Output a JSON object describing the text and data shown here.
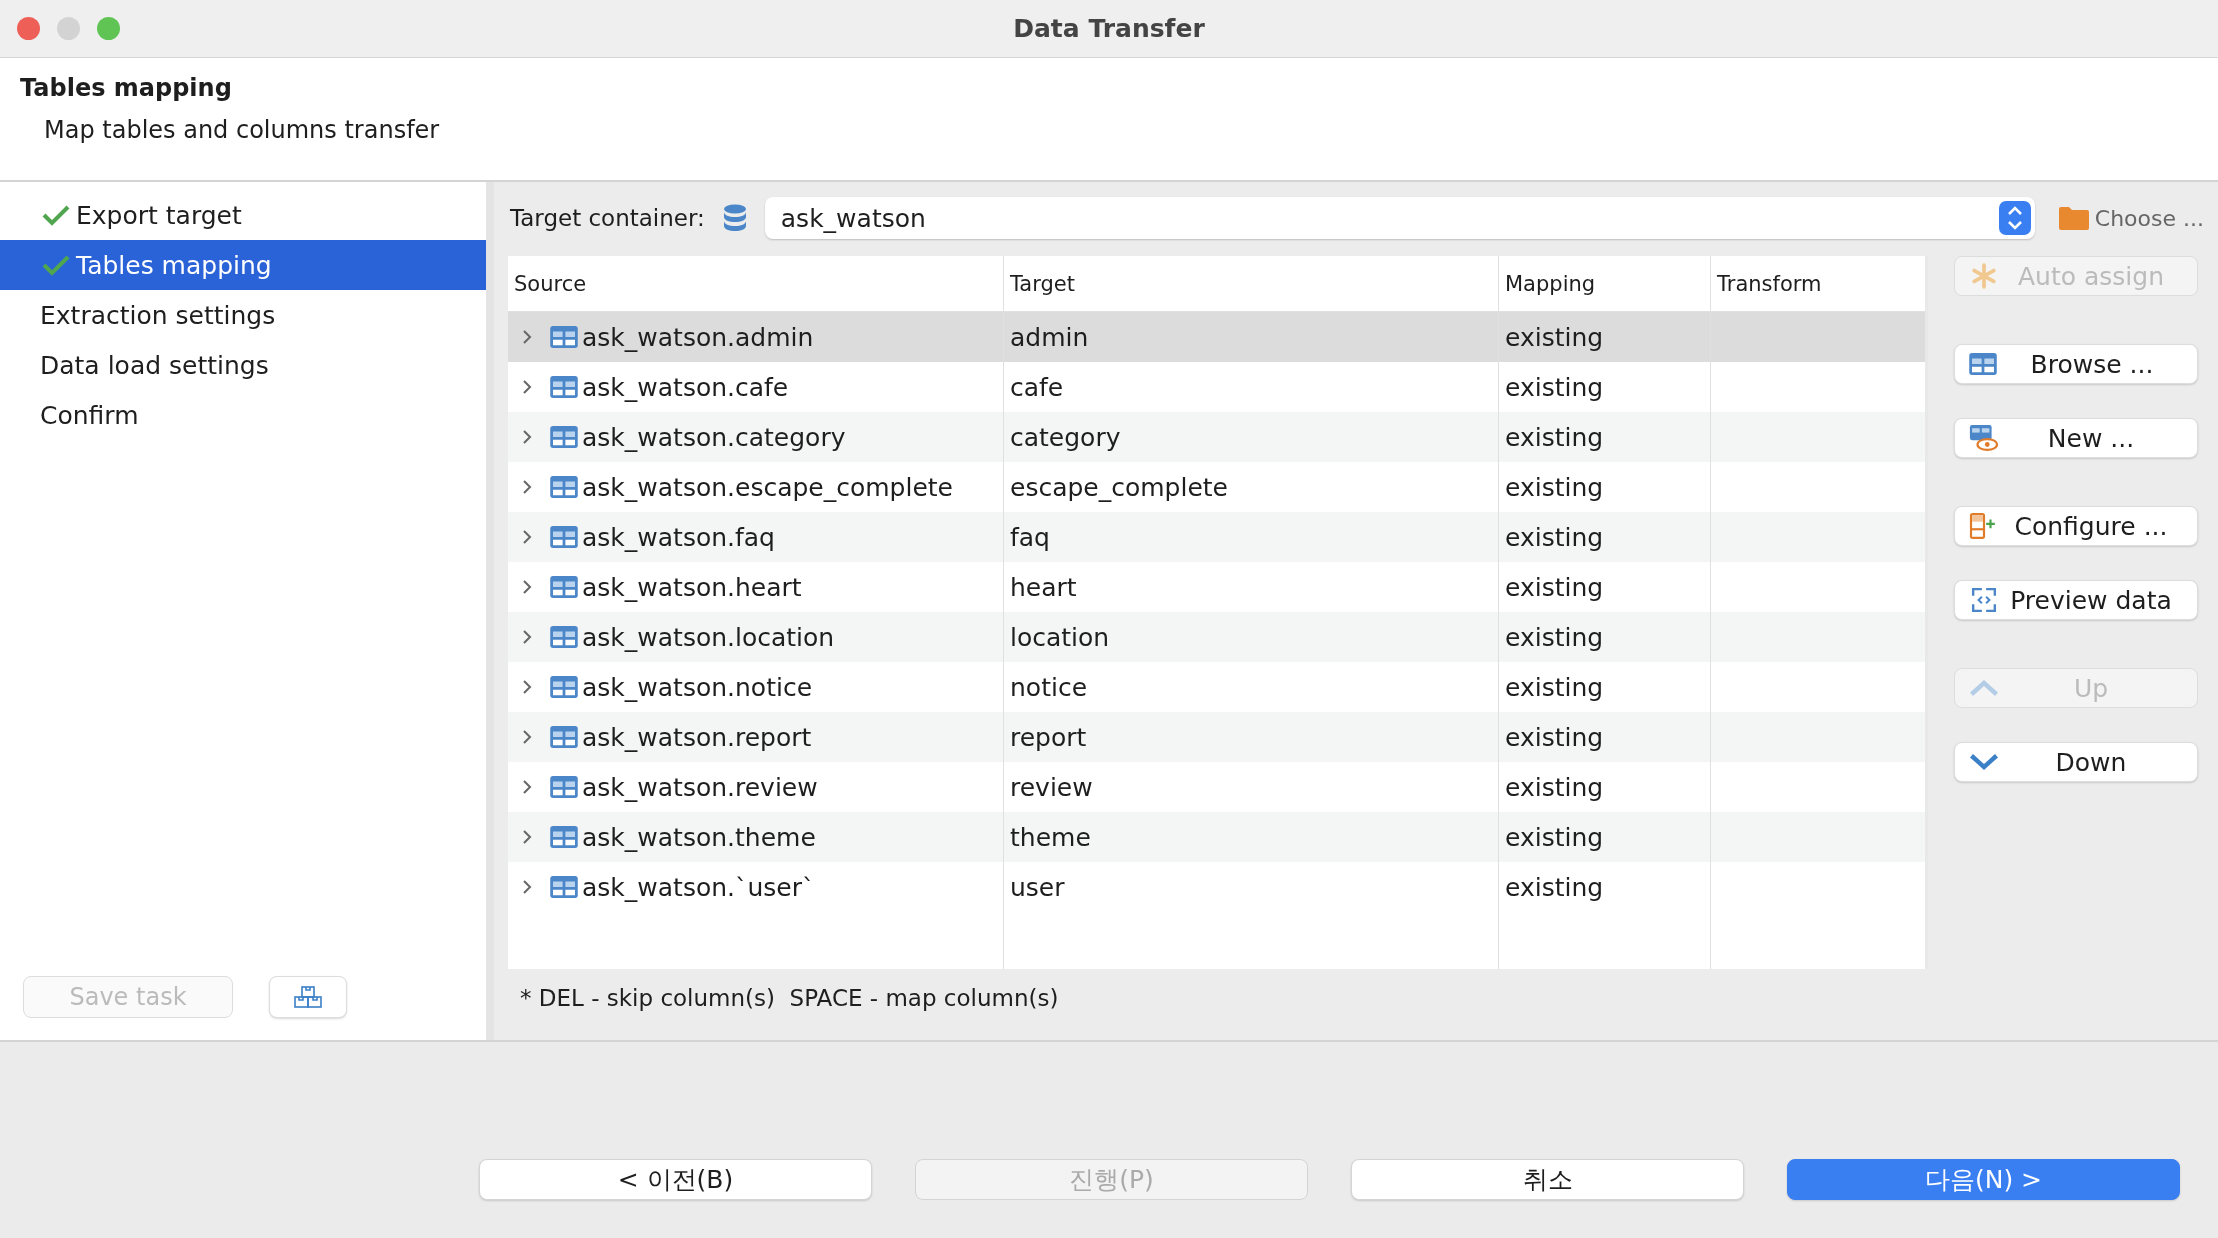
{
  "window": {
    "title": "Data Transfer"
  },
  "header": {
    "title": "Tables mapping",
    "subtitle": "Map tables and columns transfer"
  },
  "steps": [
    {
      "label": "Export target",
      "done": true,
      "selected": false
    },
    {
      "label": "Tables mapping",
      "done": true,
      "selected": true
    },
    {
      "label": "Extraction settings",
      "done": false,
      "selected": false
    },
    {
      "label": "Data load settings",
      "done": false,
      "selected": false
    },
    {
      "label": "Confirm",
      "done": false,
      "selected": false
    }
  ],
  "save_task": {
    "label": "Save task",
    "disabled": true
  },
  "target_container": {
    "label": "Target container:",
    "value": "ask_watson",
    "choose": "Choose ..."
  },
  "table": {
    "columns": [
      "Source",
      "Target",
      "Mapping",
      "Transform"
    ],
    "rows": [
      {
        "source": "ask_watson.admin",
        "target": "admin",
        "mapping": "existing",
        "selected": true
      },
      {
        "source": "ask_watson.cafe",
        "target": "cafe",
        "mapping": "existing",
        "selected": false
      },
      {
        "source": "ask_watson.category",
        "target": "category",
        "mapping": "existing",
        "selected": false
      },
      {
        "source": "ask_watson.escape_complete",
        "target": "escape_complete",
        "mapping": "existing",
        "selected": false
      },
      {
        "source": "ask_watson.faq",
        "target": "faq",
        "mapping": "existing",
        "selected": false
      },
      {
        "source": "ask_watson.heart",
        "target": "heart",
        "mapping": "existing",
        "selected": false
      },
      {
        "source": "ask_watson.location",
        "target": "location",
        "mapping": "existing",
        "selected": false
      },
      {
        "source": "ask_watson.notice",
        "target": "notice",
        "mapping": "existing",
        "selected": false
      },
      {
        "source": "ask_watson.report",
        "target": "report",
        "mapping": "existing",
        "selected": false
      },
      {
        "source": "ask_watson.review",
        "target": "review",
        "mapping": "existing",
        "selected": false
      },
      {
        "source": "ask_watson.theme",
        "target": "theme",
        "mapping": "existing",
        "selected": false
      },
      {
        "source": "ask_watson.`user`",
        "target": "user",
        "mapping": "existing",
        "selected": false
      }
    ]
  },
  "side_buttons": [
    {
      "kind": "auto",
      "label": "Auto assign",
      "disabled": true
    },
    {
      "kind": "browse",
      "label": "Browse ...",
      "disabled": false
    },
    {
      "kind": "new",
      "label": "New ...",
      "disabled": false
    },
    {
      "kind": "configure",
      "label": "Configure ...",
      "disabled": false
    },
    {
      "kind": "preview",
      "label": "Preview data",
      "disabled": false
    },
    {
      "kind": "up",
      "label": "Up",
      "disabled": true
    },
    {
      "kind": "down",
      "label": "Down",
      "disabled": false
    }
  ],
  "hint": "* DEL - skip column(s)  SPACE - map column(s)",
  "nav_buttons": [
    {
      "label": "< 이전(B)",
      "disabled": false,
      "primary": false
    },
    {
      "label": "진행(P)",
      "disabled": true,
      "primary": false
    },
    {
      "label": "취소",
      "disabled": false,
      "primary": false
    },
    {
      "label": "다음(N) >",
      "disabled": false,
      "primary": true
    }
  ]
}
